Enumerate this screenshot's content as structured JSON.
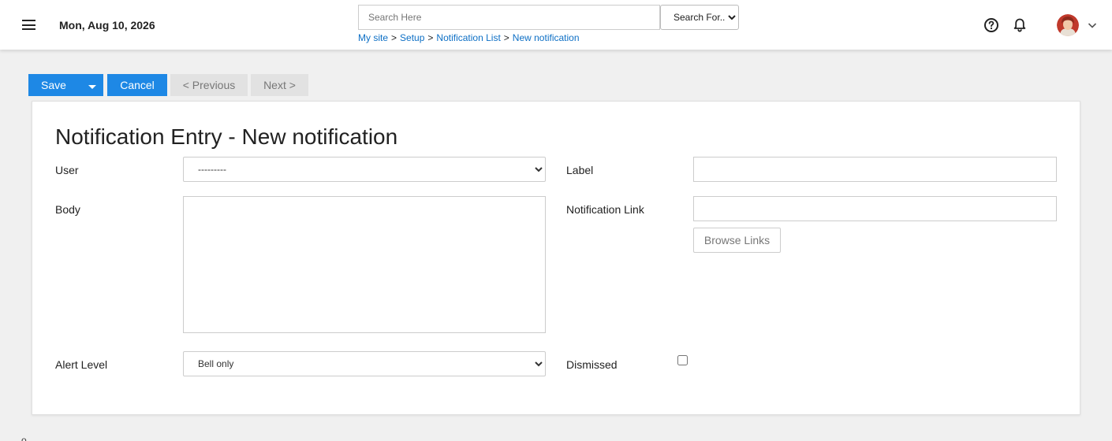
{
  "header": {
    "date": "Mon, Aug 10, 2026",
    "search_placeholder": "Search Here",
    "search_for_label": "Search For...",
    "breadcrumb": [
      {
        "label": "My site"
      },
      {
        "label": "Setup"
      },
      {
        "label": "Notification List"
      },
      {
        "label": "New notification"
      }
    ],
    "separator": ">"
  },
  "toolbar": {
    "save_label": "Save",
    "cancel_label": "Cancel",
    "previous_label": "< Previous",
    "next_label": "Next >"
  },
  "form": {
    "title": "Notification Entry - New notification",
    "user_label": "User",
    "user_value": "---------",
    "label_label": "Label",
    "label_value": "",
    "body_label": "Body",
    "body_value": "",
    "notification_link_label": "Notification Link",
    "notification_link_value": "",
    "browse_links_label": "Browse Links",
    "alert_level_label": "Alert Level",
    "alert_level_value": "Bell only",
    "dismissed_label": "Dismissed",
    "dismissed_checked": false
  },
  "footer": {
    "mark": "o"
  },
  "colors": {
    "accent": "#1e88e5",
    "link": "#0d6fc5",
    "disabled_button_bg": "#e2e2e2",
    "page_bg": "#f0f0f0"
  },
  "icons": [
    "menu-icon",
    "help-circle-icon",
    "bell-icon",
    "avatar",
    "chevron-down-icon",
    "caret-down-icon"
  ]
}
